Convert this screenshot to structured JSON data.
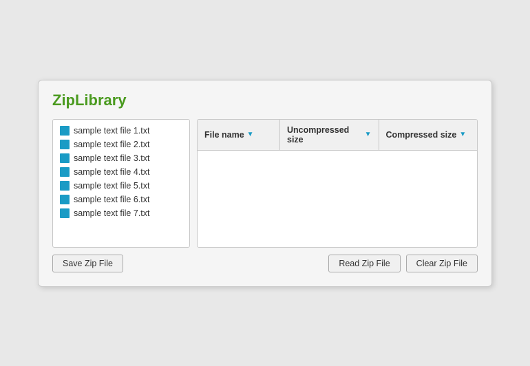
{
  "title": "ZipLibrary",
  "fileList": {
    "items": [
      {
        "id": 1,
        "name": "sample text file 1.txt"
      },
      {
        "id": 2,
        "name": "sample text file 2.txt"
      },
      {
        "id": 3,
        "name": "sample text file 3.txt"
      },
      {
        "id": 4,
        "name": "sample text file 4.txt"
      },
      {
        "id": 5,
        "name": "sample text file 5.txt"
      },
      {
        "id": 6,
        "name": "sample text file 6.txt"
      },
      {
        "id": 7,
        "name": "sample text file 7.txt"
      }
    ]
  },
  "table": {
    "columns": [
      {
        "id": "filename",
        "label": "File name",
        "hasFilter": true
      },
      {
        "id": "uncompressed",
        "label": "Uncompressed size",
        "hasFilter": true
      },
      {
        "id": "compressed",
        "label": "Compressed size",
        "hasFilter": true
      }
    ],
    "rows": []
  },
  "buttons": {
    "saveZip": "Save Zip File",
    "readZip": "Read Zip File",
    "clearZip": "Clear Zip File"
  }
}
